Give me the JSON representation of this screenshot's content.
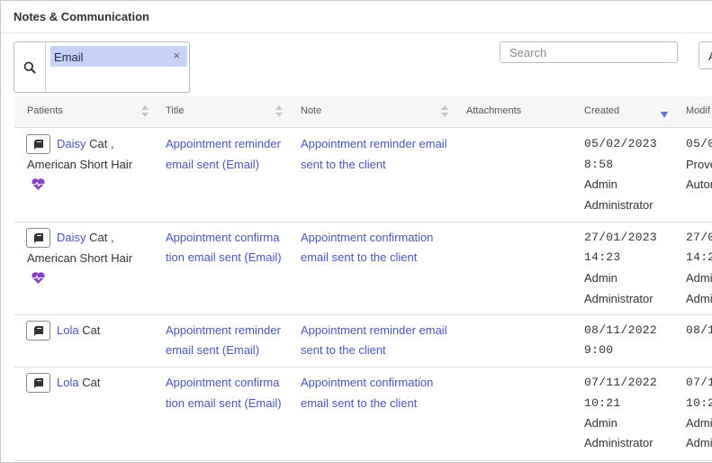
{
  "panel": {
    "title": "Notes & Communication"
  },
  "filter": {
    "tag_label": "Email",
    "tag_remove": "×"
  },
  "search": {
    "placeholder": "Search"
  },
  "right_button": {
    "label": "A"
  },
  "columns": {
    "patients": "Patients",
    "title": "Title",
    "note": "Note",
    "attachments": "Attachments",
    "created": "Created",
    "modified": "Modif"
  },
  "rows": [
    {
      "patient_name": "Daisy",
      "patient_rest1": " Cat ,",
      "patient_rest2": "American Short Hair",
      "title1": "Appointment reminder",
      "title2": "email sent (Email)",
      "note1": "Appointment reminder email",
      "note2": "sent to the client",
      "created1": "05/02/2023",
      "created2": "8:58",
      "created3": "Admin",
      "created4": "Administrator",
      "mod1": "05/0",
      "mod2": "Prove",
      "mod3": "Autor"
    },
    {
      "patient_name": "Daisy",
      "patient_rest1": " Cat ,",
      "patient_rest2": "American Short Hair",
      "title1": "Appointment confirma",
      "title2": "tion email sent (Email)",
      "note1": "Appointment confirmation",
      "note2": "email sent to the client",
      "created1": "27/01/2023",
      "created2": "14:23",
      "created3": "Admin",
      "created4": "Administrator",
      "mod1": "27/0",
      "mod2": "14:2",
      "mod3": "Admi",
      "mod4": "Admi"
    },
    {
      "patient_name": "Lola",
      "patient_rest1": " Cat",
      "title1": "Appointment reminder",
      "title2": "email sent (Email)",
      "note1": "Appointment reminder email",
      "note2": "sent to the client",
      "created1": "08/11/2022",
      "created2": "9:00",
      "mod1": "08/1"
    },
    {
      "patient_name": "Lola",
      "patient_rest1": " Cat",
      "title1": "Appointment confirma",
      "title2": "tion email sent (Email)",
      "note1": "Appointment confirmation",
      "note2": "email sent to the client",
      "created1": "07/11/2022",
      "created2": "10:21",
      "created3": "Admin",
      "created4": "Administrator",
      "mod1": "07/1",
      "mod2": "10:2",
      "mod3": "Admi",
      "mod4": "Admi"
    }
  ],
  "colors": {
    "link": "#4a56b8",
    "tag_bg": "#c6d2f6",
    "heart": "#8b3fc7",
    "sort_active": "#6a6fd2"
  },
  "icons": {
    "search": "search-icon",
    "record": "medical-record-icon",
    "heart": "heartbeat-icon"
  }
}
